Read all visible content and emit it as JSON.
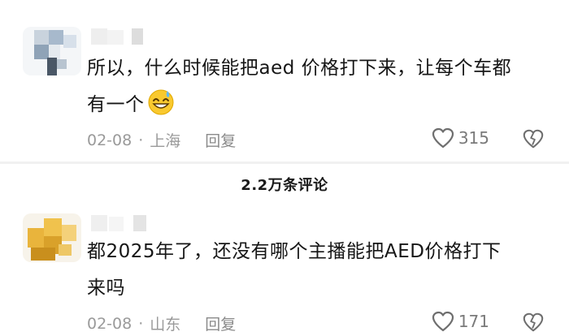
{
  "comments": [
    {
      "text_line1": "所以，什么时候能把aed 价格打下来，让每个车都",
      "text_line2": "有一个",
      "emoji": "grinning-sweat-emoji",
      "date": "02-08",
      "separator": "·",
      "location": "上海",
      "reply_label": "回复",
      "likes": "315"
    },
    {
      "text_line1": "都2025年了，还没有哪个主播能把AED价格打下",
      "text_line2": "来吗",
      "date": "02-08",
      "separator": "·",
      "location": "山东",
      "reply_label": "回复",
      "likes": "171"
    }
  ],
  "total_comments_label": "2.2万条评论",
  "colors": {
    "text": "#161616",
    "meta": "#9a9a9a",
    "divider": "#f1f1f1"
  }
}
